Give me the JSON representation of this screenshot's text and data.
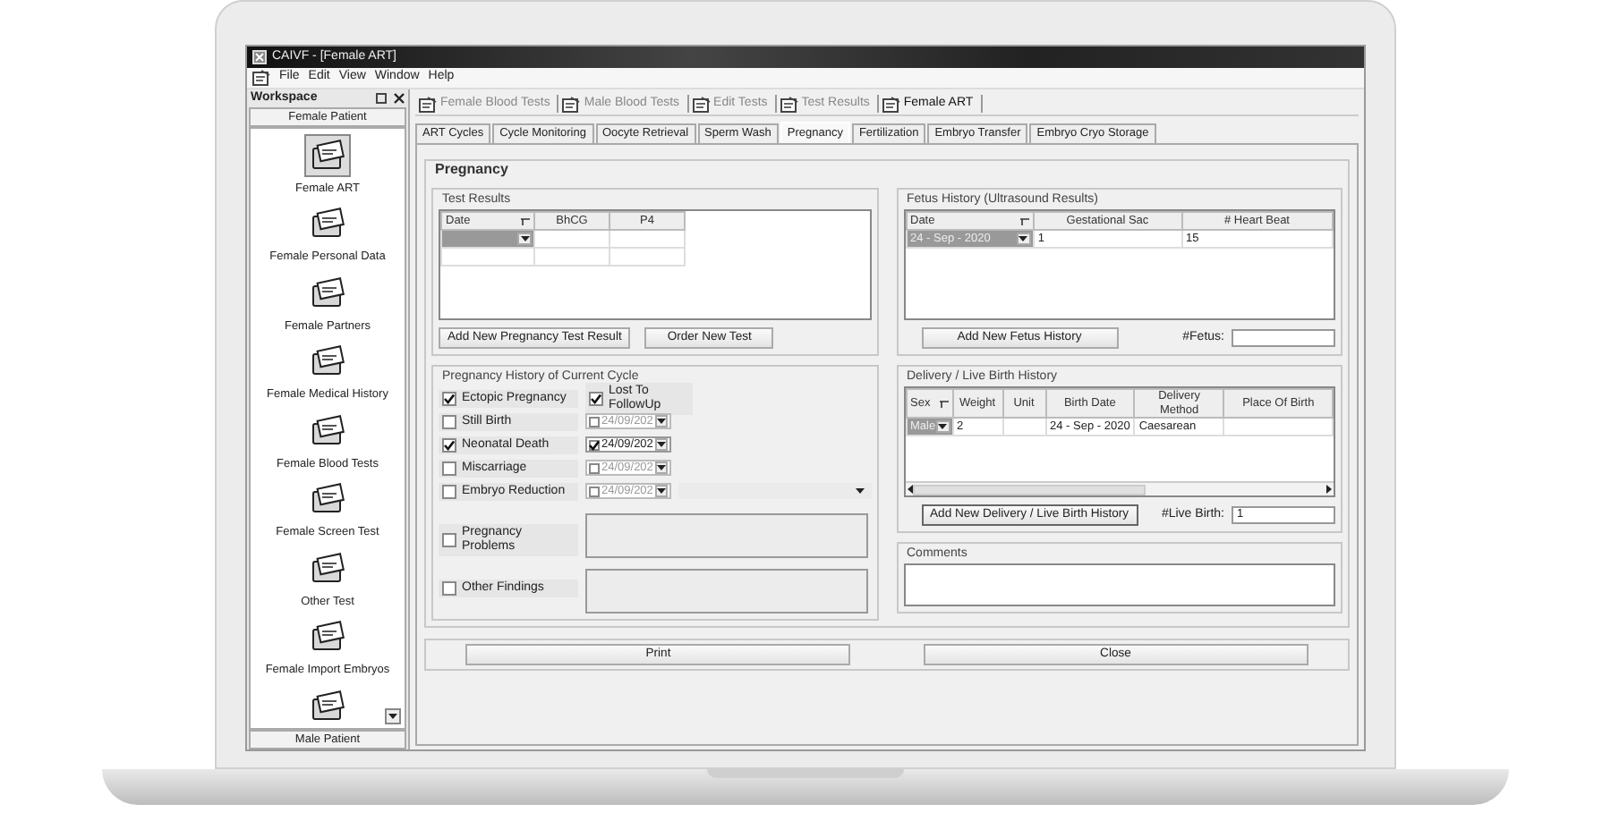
{
  "window": {
    "title": "CAIVF - [Female ART]"
  },
  "menu": [
    "File",
    "Edit",
    "View",
    "Window",
    "Help"
  ],
  "workspace": {
    "title": "Workspace",
    "group": "Female Patient",
    "next_group": "Male Patient",
    "items": [
      {
        "label": "Female ART",
        "selected": true
      },
      {
        "label": "Female Personal Data",
        "selected": false
      },
      {
        "label": "Female Partners",
        "selected": false
      },
      {
        "label": "Female Medical History",
        "selected": false
      },
      {
        "label": "Female Blood Tests",
        "selected": false
      },
      {
        "label": "Female Screen Test",
        "selected": false
      },
      {
        "label": "Other Test",
        "selected": false
      },
      {
        "label": "Female Import Embryos",
        "selected": false
      },
      {
        "selected": false
      }
    ]
  },
  "doc_tabs": [
    {
      "label": "Female Blood Tests",
      "selected": false
    },
    {
      "label": "Male Blood Tests",
      "selected": false
    },
    {
      "label": "Edit Tests",
      "selected": false
    },
    {
      "label": "Test Results",
      "selected": false
    },
    {
      "label": "Female ART",
      "selected": true
    }
  ],
  "sub_tabs": [
    {
      "label": "ART Cycles",
      "selected": false
    },
    {
      "label": "Cycle Monitoring",
      "selected": false
    },
    {
      "label": "Oocyte Retrieval",
      "selected": false
    },
    {
      "label": "Sperm Wash",
      "selected": false
    },
    {
      "label": "Pregnancy",
      "selected": true
    },
    {
      "label": "Fertilization",
      "selected": false
    },
    {
      "label": "Embryo Transfer",
      "selected": false
    },
    {
      "label": "Embryo Cryo Storage",
      "selected": false
    }
  ],
  "pregnancy": {
    "title": "Pregnancy",
    "test_results": {
      "title": "Test Results",
      "columns": [
        "Date",
        "BhCG",
        "P4"
      ],
      "rows": [
        {
          "selected": true
        },
        {
          "selected": false
        }
      ],
      "buttons": [
        "Add New Pregnancy Test Result",
        "Order New Test"
      ]
    },
    "history": {
      "title": "Pregnancy History of Current Cycle",
      "items": [
        {
          "kind": "pair",
          "label": "Ectopic Pregnancy",
          "checked": true,
          "second_label": "Lost To FollowUp",
          "second_checked": true
        },
        {
          "kind": "date",
          "label": "Still Birth",
          "checked": false,
          "date": "24/09/202",
          "date_checked": false,
          "date_enabled": false
        },
        {
          "kind": "date",
          "label": "Neonatal Death",
          "checked": true,
          "date": "24/09/202",
          "date_checked": true,
          "date_enabled": true
        },
        {
          "kind": "date",
          "label": "Miscarriage",
          "checked": false,
          "date": "24/09/202",
          "date_checked": false,
          "date_enabled": false
        },
        {
          "kind": "date_combo",
          "label": "Embryo Reduction",
          "checked": false,
          "date": "24/09/202",
          "date_checked": false,
          "date_enabled": false
        },
        {
          "kind": "notes",
          "label": "Pregnancy Problems",
          "checked": false
        },
        {
          "kind": "notes",
          "label": "Other Findings",
          "checked": false
        }
      ]
    },
    "fetus_history": {
      "title": "Fetus History (Ultrasound Results)",
      "columns": [
        "Date",
        "Gestational Sac",
        "# Heart Beat"
      ],
      "rows": [
        {
          "selected": true,
          "date": "24 - Sep - 2020",
          "gestational_sac": "1",
          "heart_beat": "15"
        }
      ],
      "button": "Add New Fetus History",
      "count_label": "#Fetus:"
    },
    "delivery": {
      "title": "Delivery / Live Birth History",
      "columns": [
        "Sex",
        "Weight",
        "Unit",
        "Birth Date",
        "Delivery Method",
        "Place Of Birth"
      ],
      "rows": [
        {
          "selected": true,
          "cells": [
            "Male",
            "2",
            "",
            "24 - Sep - 2020",
            "Caesarean",
            ""
          ]
        }
      ],
      "button": "Add New Delivery / Live Birth History",
      "count_label": "#Live Birth:",
      "count_value": "1"
    },
    "comments": {
      "title": "Comments"
    }
  },
  "footer_buttons": [
    "Print",
    "Close"
  ]
}
